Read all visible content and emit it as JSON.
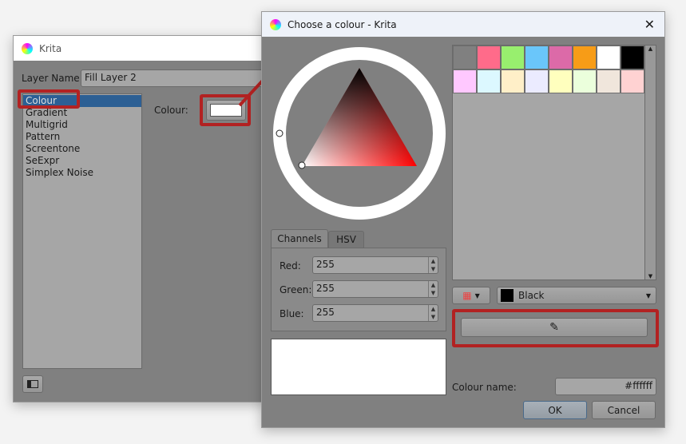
{
  "back_window": {
    "title": "Krita",
    "layer_name_label": "Layer Name:",
    "layer_name_value": "Fill Layer 2",
    "fill_types": [
      "Colour",
      "Gradient",
      "Multigrid",
      "Pattern",
      "Screentone",
      "SeExpr",
      "Simplex Noise"
    ],
    "colour_label": "Colour:",
    "colour_value": "#ffffff"
  },
  "dialog": {
    "title": "Choose a colour - Krita",
    "tabs": [
      "Channels",
      "HSV"
    ],
    "channels": [
      {
        "label": "Red:",
        "value": "255"
      },
      {
        "label": "Green:",
        "value": "255"
      },
      {
        "label": "Blue:",
        "value": "255"
      }
    ],
    "palette_row1": [
      "#808080",
      "#ff6b8a",
      "#98ef6e",
      "#6ac6fa",
      "#dc6aa8",
      "#f79c17",
      "#ffffff",
      "#000000"
    ],
    "palette_row2": [
      "#ffc8ff",
      "#dcf8ff",
      "#ffefc8",
      "#ebebff",
      "#ffffbe",
      "#ebffdc",
      "#f0e6dc",
      "#ffd2d2"
    ],
    "palette_select": "Black",
    "colour_name_label": "Colour name:",
    "colour_name_value": "#ffffff",
    "ok": "OK",
    "cancel": "Cancel"
  },
  "colors": {
    "highlight": "#b22222",
    "selection": "#2c5f94"
  }
}
